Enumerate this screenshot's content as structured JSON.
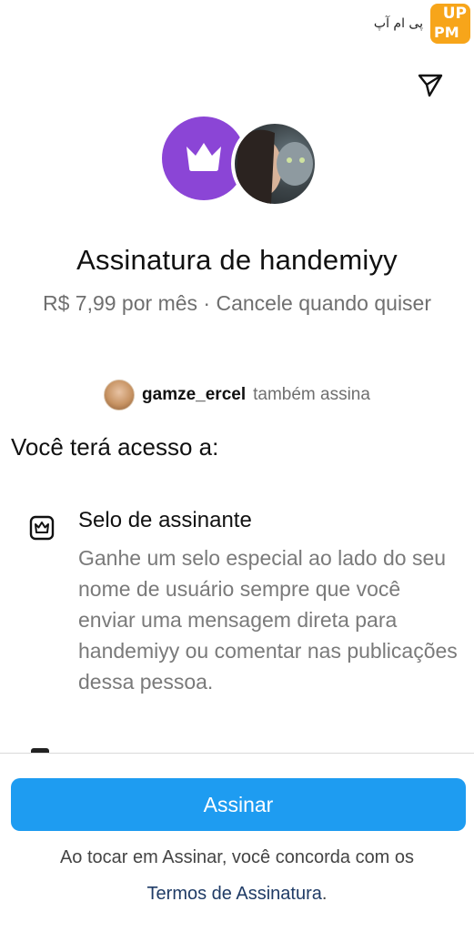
{
  "watermark": {
    "text": "پی ام آپ",
    "logo_top": "UP",
    "logo_bottom": "PM"
  },
  "header": {
    "share_icon": "send-icon"
  },
  "avatars": {
    "crown_icon": "crown-icon",
    "crown_bg_color": "#8b45d6"
  },
  "subscription": {
    "title": "Assinatura de handemiyy",
    "price_line": "R$ 7,99 por mês · Cancele quando quiser"
  },
  "social_proof": {
    "username": "gamze_ercel",
    "label": "também assina"
  },
  "access": {
    "heading": "Você terá acesso a:",
    "benefits": [
      {
        "icon": "subscriber-badge-icon",
        "title": "Selo de assinante",
        "description": "Ganhe um selo especial ao lado do seu nome de usuário sempre que você enviar uma mensagem direta para handemiyy ou comentar nas publicações dessa pessoa."
      }
    ]
  },
  "footer": {
    "button_label": "Assinar",
    "button_color": "#1e9cf1",
    "legal_text": "Ao tocar em Assinar, você concorda com os",
    "terms_link": "Termos de Assinatura",
    "terms_suffix": "."
  }
}
